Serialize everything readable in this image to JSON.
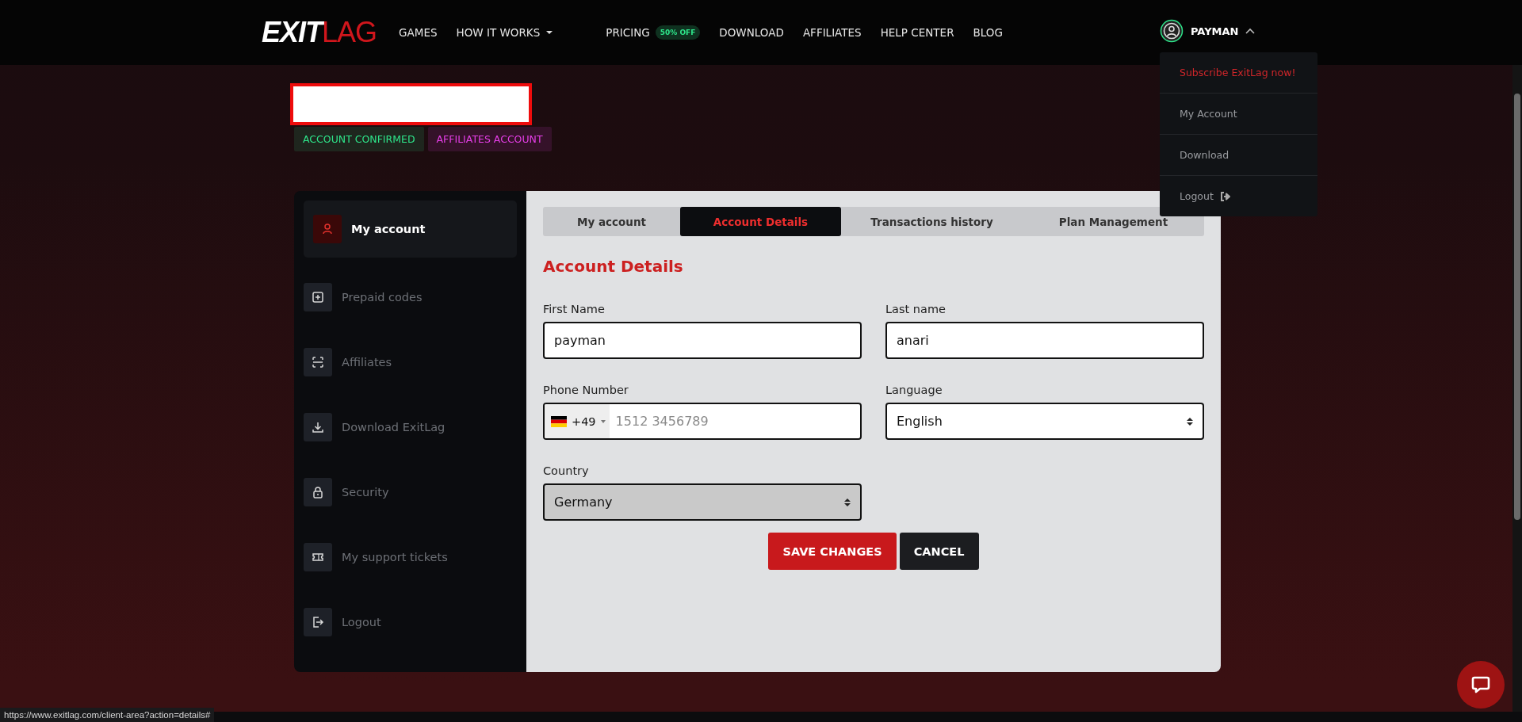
{
  "header": {
    "logo": [
      "EXIT",
      "LAG"
    ],
    "nav": [
      {
        "label": "GAMES",
        "has_menu": false
      },
      {
        "label": "HOW IT WORKS",
        "has_menu": true
      },
      {
        "label": "PRICING",
        "has_menu": false,
        "badge": "50% OFF"
      },
      {
        "label": "DOWNLOAD",
        "has_menu": false
      },
      {
        "label": "AFFILIATES",
        "has_menu": false
      },
      {
        "label": "HELP CENTER",
        "has_menu": false
      },
      {
        "label": "BLOG",
        "has_menu": false
      }
    ],
    "user": {
      "name": "PAYMAN",
      "expanded": true
    },
    "user_menu": [
      {
        "label": "Subscribe ExitLag now!",
        "kind": "promo"
      },
      {
        "label": "My Account",
        "kind": "link"
      },
      {
        "label": "Download",
        "kind": "link"
      },
      {
        "label": "Logout",
        "kind": "logout"
      }
    ]
  },
  "email_field": {
    "invalid": true
  },
  "badges": [
    {
      "label": "ACCOUNT CONFIRMED",
      "color": "#2ee58a"
    },
    {
      "label": "AFFILIATES ACCOUNT",
      "color": "#e63ee8"
    }
  ],
  "sidebar": {
    "items": [
      {
        "label": "My account",
        "kind": "user",
        "selected": true
      },
      {
        "label": "Prepaid codes",
        "kind": "plus",
        "selected": false
      },
      {
        "label": "Affiliates",
        "kind": "scan",
        "selected": false
      },
      {
        "label": "Download ExitLag",
        "kind": "download",
        "selected": false
      },
      {
        "label": "Security",
        "kind": "lock",
        "selected": false
      },
      {
        "label": "My support tickets",
        "kind": "ticket",
        "selected": false
      },
      {
        "label": "Logout",
        "kind": "logout",
        "selected": false
      }
    ]
  },
  "tabs": [
    {
      "label": "My account",
      "selected": false
    },
    {
      "label": "Account Details",
      "selected": true
    },
    {
      "label": "Transactions history",
      "selected": false
    },
    {
      "label": "Plan Management",
      "selected": false
    }
  ],
  "form": {
    "title": "Account Details",
    "fields": [
      {
        "label": "First Name",
        "kind": "text",
        "value": "payman"
      },
      {
        "label": "Last name",
        "kind": "text",
        "value": "anari"
      },
      {
        "label": "Phone Number",
        "kind": "phone",
        "dial_code": "+49",
        "placeholder": "1512 3456789"
      },
      {
        "label": "Language",
        "kind": "select",
        "value": "English",
        "disabled": false
      },
      {
        "label": "Country",
        "kind": "select",
        "value": "Germany",
        "disabled": true
      }
    ]
  },
  "buttons": [
    {
      "label": "SAVE CHANGES",
      "kind": "primary"
    },
    {
      "label": "CANCEL",
      "kind": "secondary"
    }
  ],
  "status_url": "https://www.exitlag.com/client-area?action=details#"
}
